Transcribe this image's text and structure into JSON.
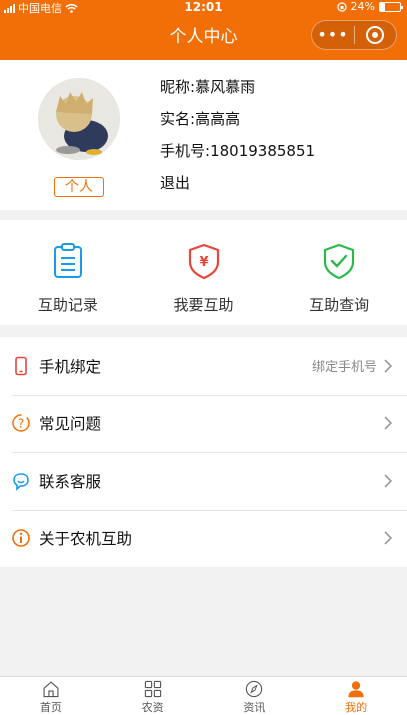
{
  "status_bar": {
    "carrier": "中国电信",
    "time": "12:01",
    "battery": "24%",
    "battery_level": 0.24
  },
  "nav": {
    "title": "个人中心",
    "more_icon": "more-dots-icon",
    "close_icon": "capsule-close-icon"
  },
  "profile": {
    "role_badge": "个人",
    "nickname_label": "昵称:",
    "nickname": "慕风慕雨",
    "realname_label": "实名:",
    "realname": "高高高",
    "phone_label": "手机号:",
    "phone": "18019385851",
    "logout": "退出"
  },
  "actions": [
    {
      "label": "互助记录",
      "icon": "clipboard-icon",
      "color": "#1a9be8"
    },
    {
      "label": "我要互助",
      "icon": "shield-yen-icon",
      "color": "#e8463a"
    },
    {
      "label": "互助查询",
      "icon": "shield-check-icon",
      "color": "#2db84a"
    }
  ],
  "menu": [
    {
      "label": "手机绑定",
      "hint": "绑定手机号",
      "icon": "phone-icon",
      "color": "#e8463a"
    },
    {
      "label": "常见问题",
      "hint": "",
      "icon": "question-icon",
      "color": "#f26f08"
    },
    {
      "label": "联系客服",
      "hint": "",
      "icon": "chat-icon",
      "color": "#1a9be8"
    },
    {
      "label": "关于农机互助",
      "hint": "",
      "icon": "info-icon",
      "color": "#f26f08"
    }
  ],
  "tabs": [
    {
      "label": "首页",
      "icon": "home-icon",
      "active": false
    },
    {
      "label": "农资",
      "icon": "grid-icon",
      "active": false
    },
    {
      "label": "资讯",
      "icon": "compass-icon",
      "active": false
    },
    {
      "label": "我的",
      "icon": "person-icon",
      "active": true
    }
  ],
  "colors": {
    "brand": "#f26f08",
    "background": "#f2f2f2"
  }
}
